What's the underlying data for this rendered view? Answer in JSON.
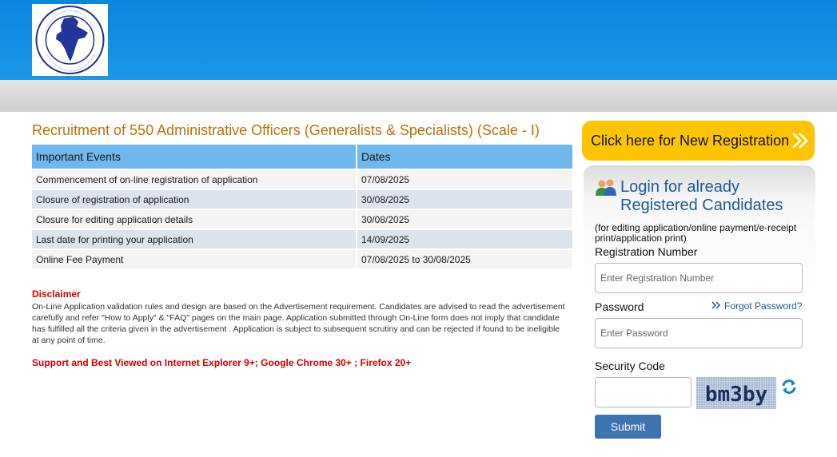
{
  "header": {
    "logo_text": "THE NEW INDIA ASSURANCE CO. LTD.",
    "logo_hindi": "दि न्यू इंडिया एश्योरेंस कं. लि."
  },
  "main": {
    "title": "Recruitment of 550 Administrative Officers (Generalists & Specialists) (Scale - I)",
    "table": {
      "headers": [
        "Important Events",
        "Dates"
      ],
      "rows": [
        [
          "Commencement of on-line registration of application",
          "07/08/2025"
        ],
        [
          "Closure of registration of application",
          "30/08/2025"
        ],
        [
          "Closure for editing application details",
          "30/08/2025"
        ],
        [
          "Last date for printing your application",
          "14/09/2025"
        ],
        [
          "Online Fee Payment",
          "07/08/2025 to 30/08/2025"
        ]
      ]
    },
    "disclaimer_title": "Disclaimer",
    "disclaimer_text": "On-Line Application validation rules and design are based on the Advertisement requirement. Candidates are advised to read the advertisement carefully and refer \"How to Apply\" & \"FAQ\" pages on the main page. Application submitted through On-Line form does not imply that candidate has fulfilled all the criteria given in the advertisement . Application is subject to subsequent scrutiny and can be rejected if found to be ineligible at any point of time.",
    "support_text": "Support and Best Viewed on Internet Explorer 9+; Google Chrome 30+ ; Firefox 20+"
  },
  "sidebar": {
    "new_registration_label": "Click here for New Registration",
    "login_title_line1": "Login for already",
    "login_title_line2": "Registered Candidates",
    "login_note": "(for editing application/online payment/e-receipt print/application print)",
    "registration_label": "Registration Number",
    "registration_placeholder": "Enter Registration Number",
    "password_label": "Password",
    "password_placeholder": "Enter Password",
    "forgot_label": "Forgot Password?",
    "security_label": "Security Code",
    "captcha_text": "bm3by",
    "submit_label": "Submit"
  },
  "colors": {
    "header_blue": "#1b98e8",
    "title_orange": "#c0700a",
    "table_header": "#6fb7ec",
    "disclaimer_red": "#d40000",
    "new_reg_yellow": "#ffc400",
    "link_blue": "#1d5a96",
    "submit_blue": "#3e72b1"
  }
}
